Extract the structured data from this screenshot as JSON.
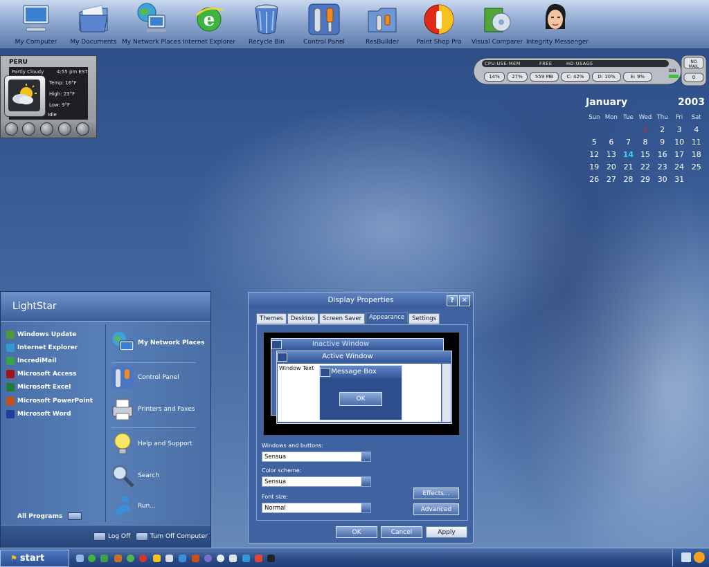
{
  "desktop_icons": [
    {
      "label": "My Computer",
      "icon": "my-computer-icon"
    },
    {
      "label": "My Documents",
      "icon": "my-documents-icon"
    },
    {
      "label": "My Network Places",
      "icon": "network-places-icon"
    },
    {
      "label": "Internet Explorer",
      "icon": "internet-explorer-icon"
    },
    {
      "label": "Recycle Bin",
      "icon": "recycle-bin-icon"
    },
    {
      "label": "Control Panel",
      "icon": "control-panel-icon"
    },
    {
      "label": "ResBuilder",
      "icon": "resbuilder-icon"
    },
    {
      "label": "Paint Shop Pro",
      "icon": "paint-shop-pro-icon"
    },
    {
      "label": "Visual Comparer",
      "icon": "visual-comparer-icon"
    },
    {
      "label": "Integrity Messenger",
      "icon": "integrity-messenger-icon"
    }
  ],
  "weather": {
    "location": "PERU",
    "condition": "Partly Cloudy",
    "time": "4:55 pm EST",
    "temp_label": "Temp:",
    "temp": "16°F",
    "high_label": "High:",
    "high": "23°F",
    "low_label": "Low:",
    "low": "9°F",
    "status": "Idle"
  },
  "sysmon": {
    "headers": [
      "CPU-USE-MEM",
      "FREE",
      "HD-USAGE"
    ],
    "values": [
      "14%",
      "27%",
      "559 MB",
      "C: 42%",
      "D: 10%",
      "E: 9%"
    ],
    "bin_label": "BIN",
    "mail_label": "NO MAIL",
    "mail_count": "0"
  },
  "calendar": {
    "month": "January",
    "year": "2003",
    "weekdays": [
      "Sun",
      "Mon",
      "Tue",
      "Wed",
      "Thu",
      "Fri",
      "Sat"
    ],
    "weeks": [
      [
        "",
        "",
        "",
        "1",
        "2",
        "3",
        "4"
      ],
      [
        "5",
        "6",
        "7",
        "8",
        "9",
        "10",
        "11"
      ],
      [
        "12",
        "13",
        "14",
        "15",
        "16",
        "17",
        "18"
      ],
      [
        "19",
        "20",
        "21",
        "22",
        "23",
        "24",
        "25"
      ],
      [
        "26",
        "27",
        "28",
        "29",
        "30",
        "31",
        ""
      ]
    ],
    "today": "14",
    "holiday": "1"
  },
  "start_menu": {
    "title": "LightStar",
    "left_items": [
      {
        "label": "Windows Update",
        "color": "#4e9a3a"
      },
      {
        "label": "Internet Explorer",
        "color": "#2f9ad6"
      },
      {
        "label": "IncrediMail",
        "color": "#3aa04a"
      },
      {
        "label": "Microsoft Access",
        "color": "#a31515"
      },
      {
        "label": "Microsoft Excel",
        "color": "#1e7b34"
      },
      {
        "label": "Microsoft PowerPoint",
        "color": "#c8501c"
      },
      {
        "label": "Microsoft Word",
        "color": "#1f3f9c"
      }
    ],
    "right_items": [
      {
        "label": "My Network Places",
        "icon": "network-places-icon"
      },
      {
        "label": "Control Panel",
        "icon": "control-panel-icon"
      },
      {
        "label": "Printers and Faxes",
        "icon": "printer-icon"
      },
      {
        "label": "Help and Support",
        "icon": "help-bulb-icon"
      },
      {
        "label": "Search",
        "icon": "search-magnifier-icon"
      },
      {
        "label": "Run...",
        "icon": "run-icon"
      }
    ],
    "all_programs": "All Programs",
    "log_off": "Log Off",
    "turn_off": "Turn Off Computer"
  },
  "display_properties": {
    "title": "Display Properties",
    "help_glyph": "?",
    "close_glyph": "✕",
    "tabs": [
      "Themes",
      "Desktop",
      "Screen Saver",
      "Appearance",
      "Settings"
    ],
    "active_tab": "Appearance",
    "preview": {
      "inactive_title": "Inactive Window",
      "active_title": "Active Window",
      "window_text": "Window Text",
      "message_title": "Message Box",
      "ok": "OK"
    },
    "windows_buttons_label": "Windows and buttons:",
    "windows_buttons_value": "Sensua",
    "color_scheme_label": "Color scheme:",
    "color_scheme_value": "Sensua",
    "font_size_label": "Font size:",
    "font_size_value": "Normal",
    "effects": "Effects...",
    "advanced": "Advanced",
    "ok": "OK",
    "cancel": "Cancel",
    "apply": "Apply"
  },
  "taskbar": {
    "start_label": "start"
  }
}
